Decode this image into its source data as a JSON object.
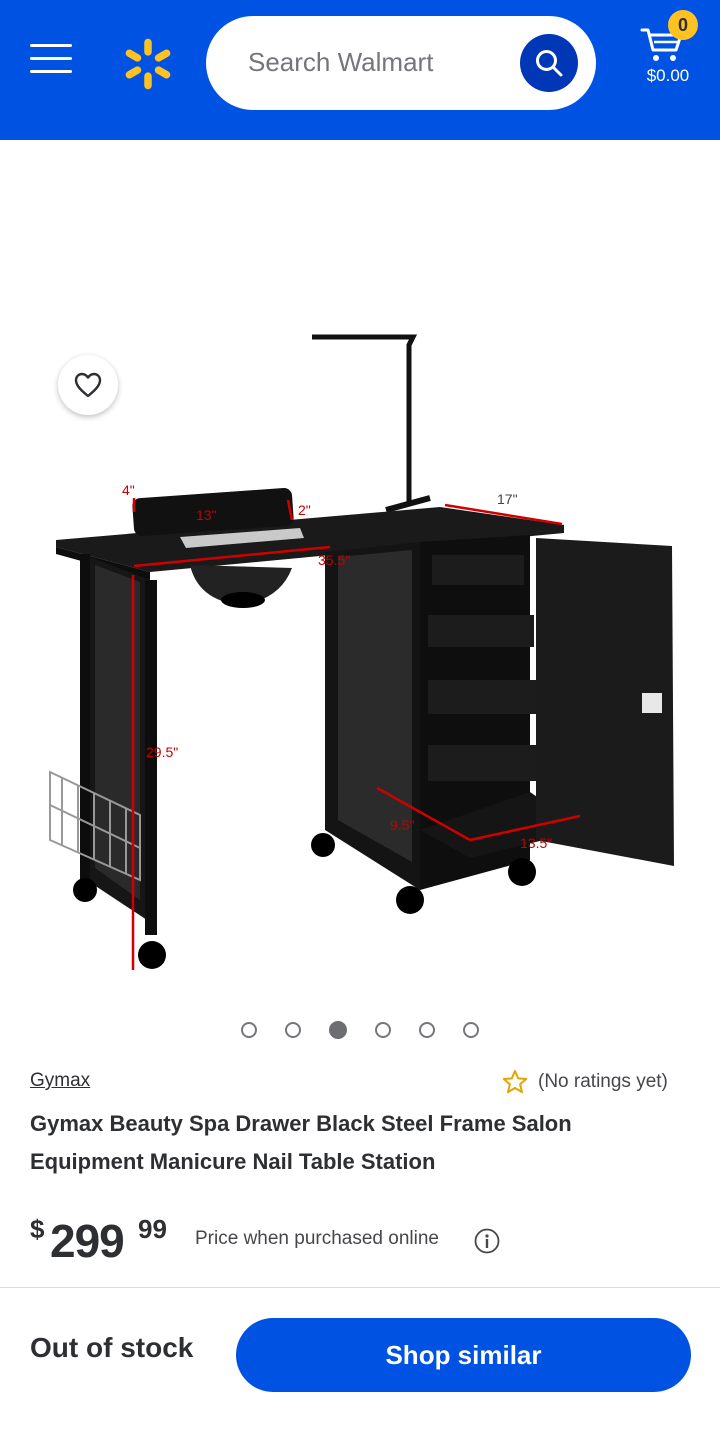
{
  "header": {
    "search_placeholder": "Search Walmart",
    "cart_count": "0",
    "cart_total": "$0.00",
    "icons": [
      "menu-icon",
      "walmart-spark-logo",
      "search-icon",
      "cart-icon"
    ]
  },
  "product": {
    "image_labels": [
      "4\"",
      "13\"",
      "2\"",
      "17\"",
      "35.5\"",
      "29.5\"",
      "9.5\"",
      "13.5\""
    ],
    "brand": "Gymax",
    "rating_text": "(No ratings yet)",
    "title": "Gymax Beauty Spa Drawer Black Steel Frame Salon Equipment Manicure Nail Table Station",
    "price_symbol": "$",
    "price_dollars": "299",
    "price_cents": "99",
    "price_note": "Price when purchased online"
  },
  "carousel": {
    "count": 6,
    "active_index": 2
  },
  "footer": {
    "stock_status": "Out of stock",
    "button_label": "Shop similar"
  },
  "colors": {
    "brand_blue": "#0053e2",
    "dark_blue": "#0037b6",
    "spark_yellow": "#ffc220"
  }
}
